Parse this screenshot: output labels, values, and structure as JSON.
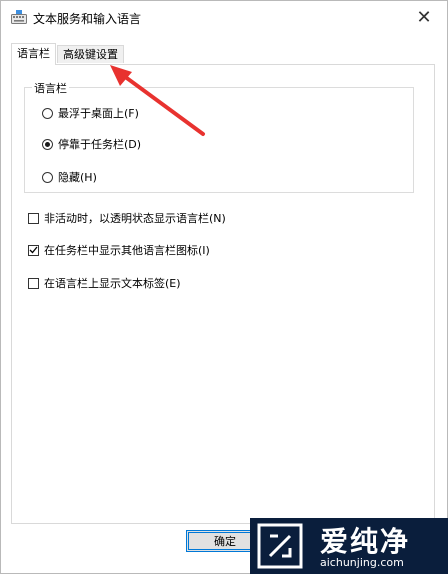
{
  "window": {
    "title": "文本服务和输入语言",
    "close_glyph": "✕"
  },
  "tabs": [
    {
      "label": "语言栏",
      "active": true
    },
    {
      "label": "高级键设置",
      "active": false
    }
  ],
  "language_bar_group": {
    "label": "语言栏",
    "options": [
      {
        "label": "最浮于桌面上(F)",
        "checked": false
      },
      {
        "label": "停靠于任务栏(D)",
        "checked": true
      },
      {
        "label": "隐藏(H)",
        "checked": false
      }
    ]
  },
  "checkboxes": [
    {
      "label": "非活动时，以透明状态显示语言栏(N)",
      "checked": false
    },
    {
      "label": "在任务栏中显示其他语言栏图标(I)",
      "checked": true
    },
    {
      "label": "在语言栏上显示文本标签(E)",
      "checked": false
    }
  ],
  "buttons": {
    "ok_label": "确定"
  },
  "watermark": {
    "title": "爱纯净",
    "url": "aichunjing.com"
  },
  "colors": {
    "accent": "#0078d7",
    "annotation_arrow": "#e8322f",
    "watermark_bg": "#0a1e3c"
  }
}
